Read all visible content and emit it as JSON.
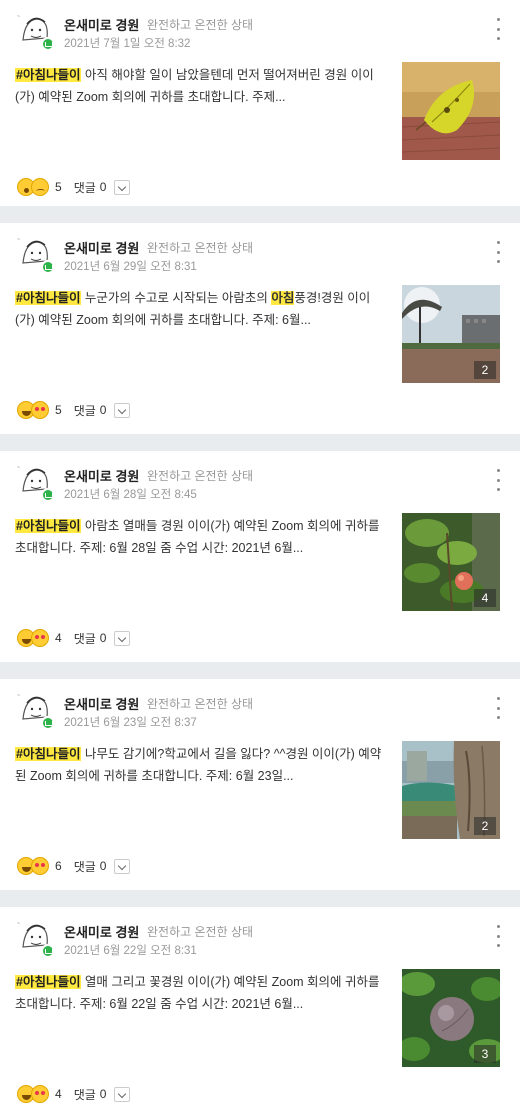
{
  "posts": [
    {
      "author": "온새미로 경원",
      "status": "완전하고 온전한 상태",
      "date": "2021년 7월 1일 오전 8:32",
      "hashtag": "#아침나들이",
      "text_before": " 아직 해야할 일이 남았을텐데 먼저 떨어져버린  경원 이이(가) 예약된 Zoom 회의에 귀하를 초대합니다.  주제...",
      "highlight": "",
      "text_after": "",
      "photo": "yellow-leaf-photo",
      "photo_count": "",
      "reactions": [
        "wow",
        "sad"
      ],
      "reaction_count": "5",
      "comment_label": "댓글",
      "comment_count": "0"
    },
    {
      "author": "온새미로 경원",
      "status": "완전하고 온전한 상태",
      "date": "2021년 6월 29일 오전 8:31",
      "hashtag": "#아침나들이",
      "text_before": "  누군가의 수고로 시작되는 아람초의 ",
      "highlight": "아침",
      "text_after": "풍경!경원 이이(가) 예약된 Zoom 회의에 귀하를 초대합니다.  주제: 6월...",
      "photo": "schoolyard-sky-photo",
      "photo_count": "2",
      "reactions": [
        "grin",
        "heart"
      ],
      "reaction_count": "5",
      "comment_label": "댓글",
      "comment_count": "0"
    },
    {
      "author": "온새미로 경원",
      "status": "완전하고 온전한 상태",
      "date": "2021년 6월 28일 오전 8:45",
      "hashtag": "#아침나들이",
      "text_before": "  아람초 열매들 경원 이이(가) 예약된 Zoom 회의에 귀하를 초대합니다.  주제: 6월 28일 줌 수업 시간: 2021년 6월...",
      "highlight": "",
      "text_after": "",
      "photo": "fruit-tree-photo",
      "photo_count": "4",
      "reactions": [
        "grin",
        "heart"
      ],
      "reaction_count": "4",
      "comment_label": "댓글",
      "comment_count": "0"
    },
    {
      "author": "온새미로 경원",
      "status": "완전하고 온전한 상태",
      "date": "2021년 6월 23일 오전 8:37",
      "hashtag": "#아침나들이",
      "text_before": "  나무도 감기에?학교에서 길을 잃다? ^^경원 이이(가) 예약된 Zoom 회의에 귀하를 초대합니다.  주제: 6월 23일...",
      "highlight": "",
      "text_after": "",
      "photo": "tree-trunk-photo",
      "photo_count": "2",
      "reactions": [
        "grin",
        "heart"
      ],
      "reaction_count": "6",
      "comment_label": "댓글",
      "comment_count": "0"
    },
    {
      "author": "온새미로 경원",
      "status": "완전하고 온전한 상태",
      "date": "2021년 6월 22일 오전 8:31",
      "hashtag": "#아침나들이",
      "text_before": "  열매 그리고 꽃경원 이이(가) 예약된 Zoom 회의에 귀하를 초대합니다.  주제: 6월 22일 줌 수업 시간: 2021년 6월...",
      "highlight": "",
      "text_after": "",
      "photo": "green-fruit-photo",
      "photo_count": "3",
      "reactions": [
        "grin",
        "heart"
      ],
      "reaction_count": "4",
      "comment_label": "댓글",
      "comment_count": "0"
    }
  ],
  "colors": {
    "hashtag_bg": "#ffe941",
    "badge": "#2eb34a",
    "meta_text": "#999999",
    "divider": "#e9ecef"
  }
}
